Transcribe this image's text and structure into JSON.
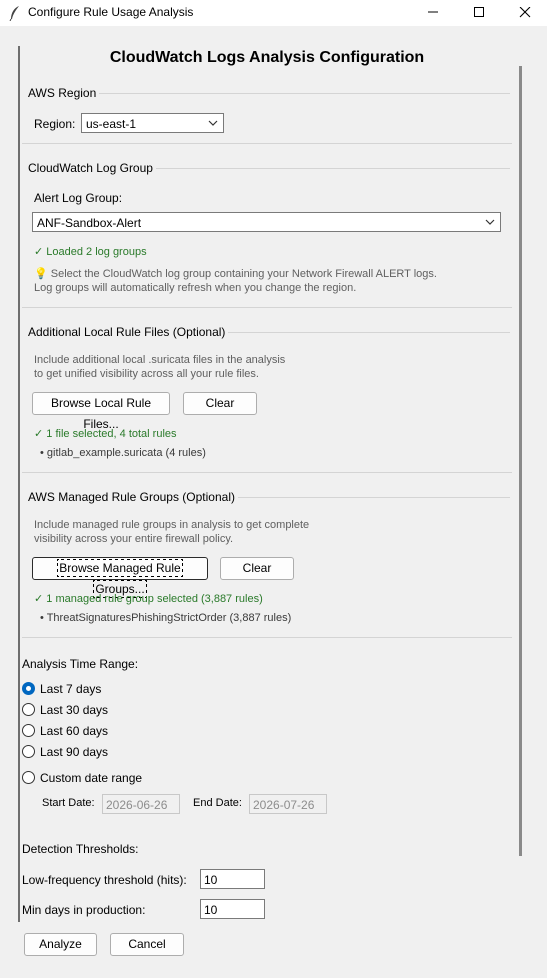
{
  "window": {
    "title": "Configure Rule Usage Analysis"
  },
  "main_title": "CloudWatch Logs Analysis Configuration",
  "region": {
    "group_title": "AWS Region",
    "label": "Region:",
    "value": "us-east-1"
  },
  "log_group": {
    "group_title": "CloudWatch Log Group",
    "label": "Alert Log Group:",
    "value": "ANF-Sandbox-Alert",
    "status": "✓ Loaded 2 log groups",
    "help_line1": "💡 Select the CloudWatch log group containing your Network Firewall ALERT logs.",
    "help_line2": "Log groups will automatically refresh when you change the region."
  },
  "local_rules": {
    "group_title": "Additional Local Rule Files (Optional)",
    "help_line1": "Include additional local .suricata files in the analysis",
    "help_line2": "to get unified visibility across all your rule files.",
    "browse_label": "Browse Local Rule Files...",
    "clear_label": "Clear",
    "status": "✓ 1 file selected, 4 total rules",
    "item": "• gitlab_example.suricata (4 rules)"
  },
  "managed_rules": {
    "group_title": "AWS Managed Rule Groups (Optional)",
    "help_line1": "Include managed rule groups in analysis to get complete",
    "help_line2": "visibility across your entire firewall policy.",
    "browse_label": "Browse Managed Rule Groups...",
    "clear_label": "Clear",
    "status": "✓ 1 managed rule group selected (3,887 rules)",
    "item": "• ThreatSignaturesPhishingStrictOrder (3,887 rules)"
  },
  "time_range": {
    "label": "Analysis Time Range:",
    "options": [
      "Last 7 days",
      "Last 30 days",
      "Last 60 days",
      "Last 90 days",
      "Custom date range"
    ],
    "selected": "Last 7 days",
    "start_label": "Start Date:",
    "start_value": "2026-06-26",
    "end_label": "End Date:",
    "end_value": "2026-07-26"
  },
  "thresholds": {
    "label": "Detection Thresholds:",
    "low_freq_label": "Low-frequency threshold (hits):",
    "low_freq_value": "10",
    "min_days_label": "Min days in production:",
    "min_days_value": "10"
  },
  "footer": {
    "analyze_label": "Analyze",
    "cancel_label": "Cancel"
  },
  "colors": {
    "accent": "#0067c0",
    "success": "#2a7a2a",
    "help_text": "#606060"
  }
}
